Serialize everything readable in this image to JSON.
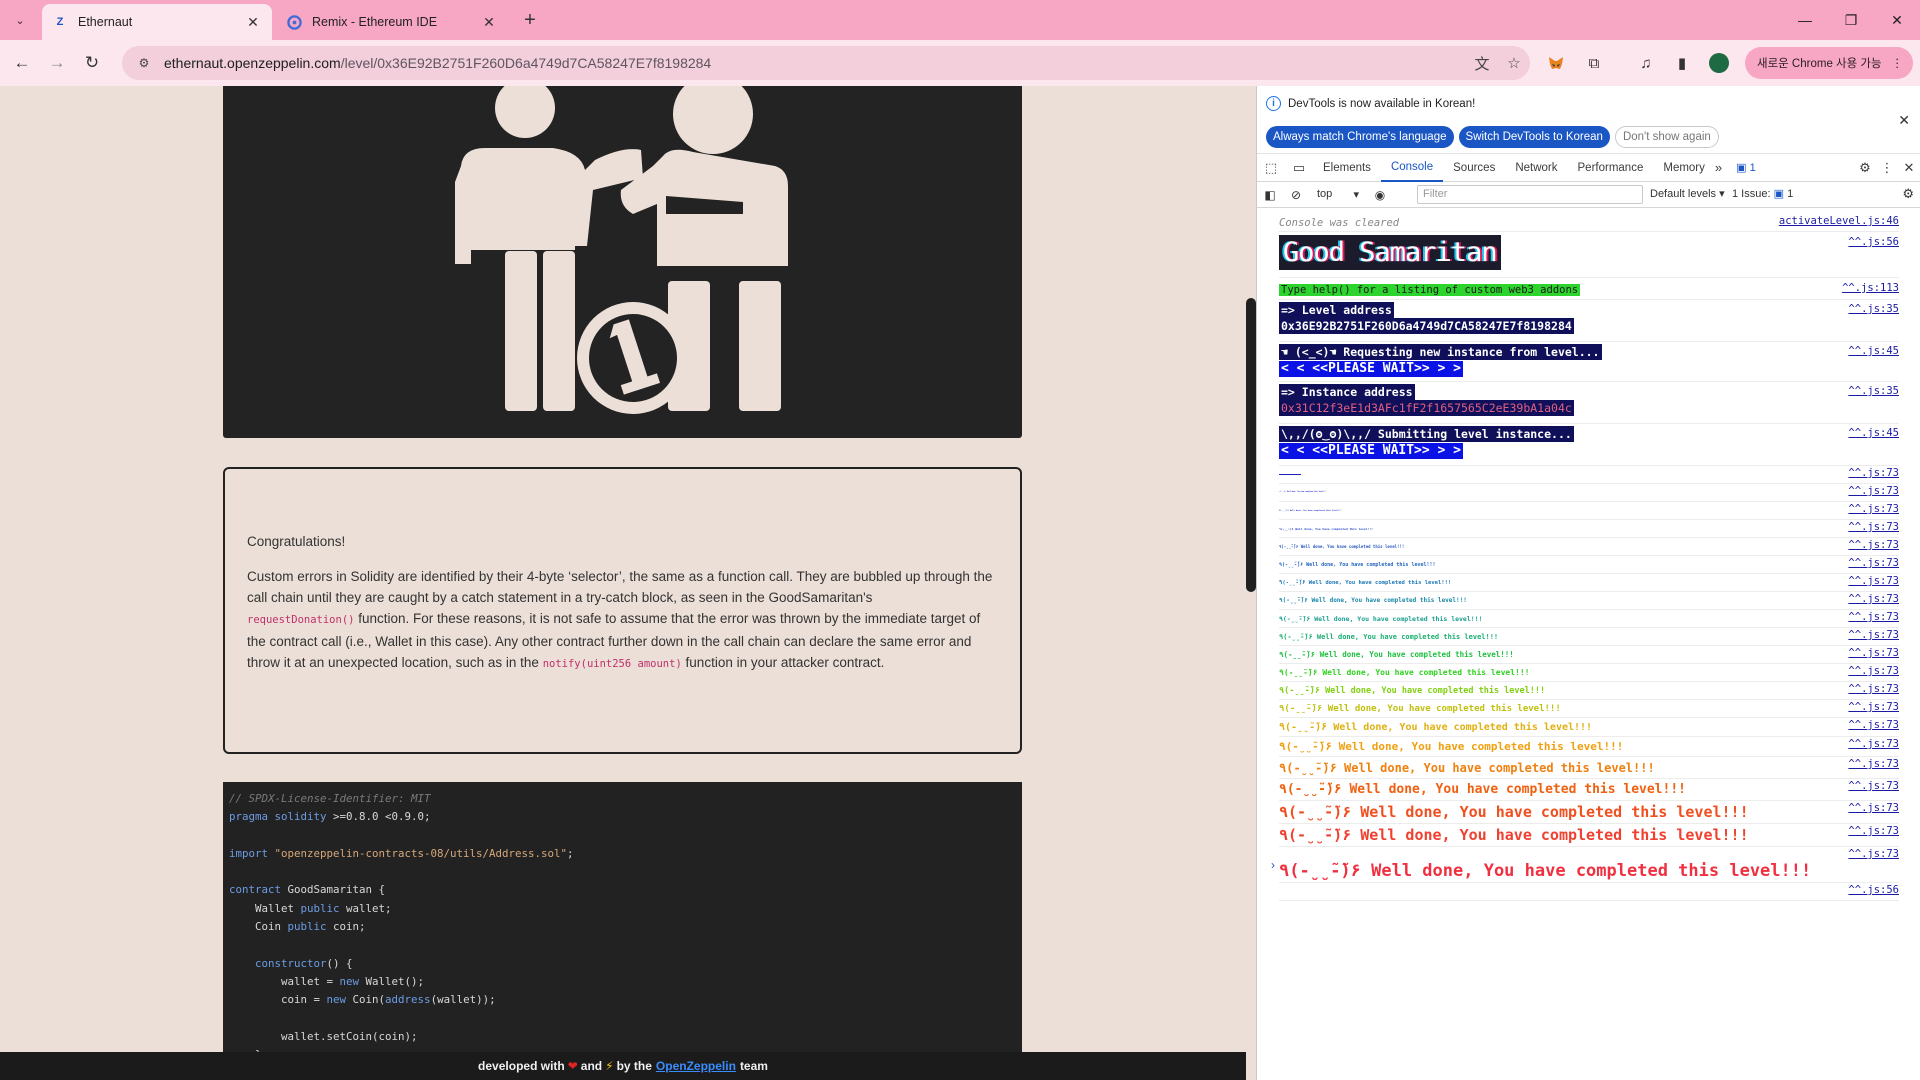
{
  "browser": {
    "tabs": [
      {
        "title": "Ethernaut",
        "favicon": "Z",
        "active": true
      },
      {
        "title": "Remix - Ethereum IDE",
        "favicon": "remix-icon",
        "active": false
      }
    ],
    "url_host": "ethernaut.openzeppelin.com",
    "url_path": "/level/0x36E92B2751F260D6a4749d7CA58247E7f8198284",
    "profile_pill": "새로운 Chrome 사용 가능",
    "colors": {
      "tabbar": "#f7a6c3",
      "toolbar": "#fde7ee"
    }
  },
  "page": {
    "card": {
      "congrats": "Congratulations!",
      "p1": "Custom errors in Solidity are identified by their 4-byte ‘selector’, the same as a function call. They are bubbled up through the call chain until they are caught by a catch statement in a try-catch block, as seen in the GoodSamaritan's",
      "code1": "requestDonation()",
      "p2": "function. For these reasons, it is not safe to assume that the error was thrown by the immediate target of the contract call (i.e., Wallet in this case). Any other contract further down in the call chain can declare the same error and throw it at an unexpected location, such as in the",
      "code2": "notify(uint256 amount)",
      "p3": "function in your attacker contract."
    },
    "code": [
      {
        "kind": "comment",
        "text": "// SPDX-License-Identifier: MIT"
      },
      {
        "kind": "pragma",
        "kw": "pragma solidity",
        "rest": " >=0.8.0 <0.9.0;"
      },
      {
        "kind": "blank",
        "text": ""
      },
      {
        "kind": "import",
        "kw": "import",
        "str": " \"openzeppelin-contracts-08/utils/Address.sol\"",
        "rest": ";"
      },
      {
        "kind": "blank",
        "text": ""
      },
      {
        "kind": "contract",
        "kw": "contract",
        "rest": " GoodSamaritan {"
      },
      {
        "kind": "decl",
        "a": "    Wallet ",
        "kw": "public",
        "b": " wallet;"
      },
      {
        "kind": "decl",
        "a": "    Coin ",
        "kw": "public",
        "b": " coin;"
      },
      {
        "kind": "blank",
        "text": ""
      },
      {
        "kind": "ctor",
        "kw": "    constructor",
        "rest": "() {"
      },
      {
        "kind": "new",
        "a": "        wallet = ",
        "kw": "new",
        "b": " Wallet();"
      },
      {
        "kind": "new2",
        "a": "        coin = ",
        "kw": "new",
        "b": " Coin(",
        "kw2": "address",
        "c": "(wallet));"
      },
      {
        "kind": "blank",
        "text": ""
      },
      {
        "kind": "plain",
        "text": "        wallet.setCoin(coin);"
      },
      {
        "kind": "plain",
        "text": "    }"
      }
    ],
    "footer": {
      "pre": "developed with",
      "and": "and",
      "by": "by the",
      "link": "OpenZeppelin",
      "post": "team"
    }
  },
  "devtools": {
    "info_text": "DevTools is now available in Korean!",
    "btn_match": "Always match Chrome's language",
    "btn_switch": "Switch DevTools to Korean",
    "btn_dont": "Don't show again",
    "tabs": [
      "Elements",
      "Console",
      "Sources",
      "Network",
      "Performance",
      "Memory"
    ],
    "active_tab": "Console",
    "issues_count": "1",
    "context": "top",
    "filter_placeholder": "Filter",
    "levels": "Default levels",
    "issue_label": "1 Issue:",
    "issue_count": "1"
  },
  "console": {
    "cleared": "Console was cleared",
    "cleared_src": "activateLevel.js:46",
    "banner": "Good Samaritan",
    "banner_src": "^^.js:56",
    "help": "Type help() for a listing of custom web3 addons",
    "help_src": "^^.js:113",
    "level_label": "=> Level address",
    "level_addr": "0x36E92B2751F260D6a4749d7CA58247E7f8198284",
    "level_src": "^^.js:35",
    "req_line": "☚ (<_<)☚ Requesting new instance from level...",
    "wait1": "<  < <<PLEASE WAIT>> >  >",
    "req_src": "^^.js:45",
    "inst_label": "=> Instance address",
    "inst_addr": "0x31C12f3eE1d3AFc1fF2f1657565C2eE39bA1a04c",
    "inst_src": "^^.js:35",
    "submit_line": "\\,,/(ʘ‿ʘ)\\,,/ Submitting level instance...",
    "wait2": "<  < <<PLEASE WAIT>> >  >",
    "submit_src": "^^.js:45",
    "welldone_text": "٩(-̮̮̃-̃)۶ Well done, You have completed this level!!!",
    "welldone_src": "^^.js:73",
    "final_src": "^^.js:56",
    "welldone_colors": [
      "#2020c0",
      "#2222c4",
      "#2233c8",
      "#2244c8",
      "#2255c0",
      "#2266c0",
      "#1a77b8",
      "#1a88a8",
      "#1aa090",
      "#1ab070",
      "#20c040",
      "#30d020",
      "#80d010",
      "#c0c010",
      "#e0b010",
      "#f0a010",
      "#f08010",
      "#f06010",
      "#f05020",
      "#f04030",
      "#f03040"
    ]
  }
}
